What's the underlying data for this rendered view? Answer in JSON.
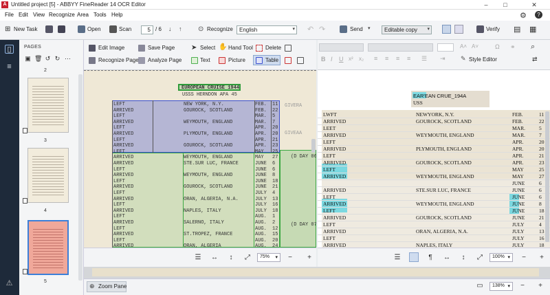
{
  "window": {
    "title": "Untitled project [5] - ABBYY FineReader 14 OCR Editor",
    "app_icon": "abbyy-icon"
  },
  "menu": [
    "File",
    "Edit",
    "View",
    "Recognize",
    "Area",
    "Tools",
    "Help"
  ],
  "toolbar": {
    "new_task": "New Task",
    "open": "Open",
    "scan": "Scan",
    "page_current": "5",
    "page_total": "/ 6",
    "recognize": "Recognize",
    "language": "English",
    "send": "Send",
    "editable": "Editable copy",
    "verify": "Verify"
  },
  "pages": {
    "header": "PAGES",
    "thumbs": [
      {
        "num": "2"
      },
      {
        "num": "3"
      },
      {
        "num": "4"
      },
      {
        "num": "5",
        "selected": true
      }
    ]
  },
  "image_tools": {
    "edit_image": "Edit Image",
    "save_page": "Save Page",
    "select": "Select",
    "hand_tool": "Hand Tool",
    "delete": "Delete",
    "recognize_page": "Recognize Page",
    "analyze_page": "Analyze Page",
    "text": "Text",
    "picture": "Picture",
    "table": "Table"
  },
  "text_tools": {
    "style_editor": "Style Editor"
  },
  "scan": {
    "title": "EUROPEAN CRUISE 1944",
    "subtitle": "USSS HERNDON APA 45",
    "rows": [
      [
        "LEFT",
        "NEW YORK, N.Y.",
        "FEB.",
        "11"
      ],
      [
        "ARRIVED",
        "GOUROCK, SCOTLAND",
        "FEB.",
        "22"
      ],
      [
        "LEFT",
        "",
        "MAR.",
        "5"
      ],
      [
        "ARRIVED",
        "WEYMOUTH, ENGLAND",
        "MAR.",
        "7"
      ],
      [
        "LEFT",
        "",
        "APR.",
        "20"
      ],
      [
        "ARRIVED",
        "PLYMOUTH, ENGLAND",
        "APR.",
        "20"
      ],
      [
        "LEFT",
        "",
        "APR.",
        "21"
      ],
      [
        "ARRIVED",
        "GOUROCK, SCOTLAND",
        "APR.",
        "23"
      ],
      [
        "LEFT",
        "",
        "MAY",
        "25"
      ],
      [
        "ARRIVED",
        "WEYMOUTH, ENGLAND",
        "MAY",
        "27"
      ],
      [
        "ARRIVED",
        "STE.SUR LUC, FRANCE",
        "JUNE",
        "6"
      ],
      [
        "LEFT",
        "",
        "JUNE",
        "6"
      ],
      [
        "ARRIVED",
        "WEYMOUTH, ENGLAND",
        "JUNE",
        "8"
      ],
      [
        "LEFT",
        "",
        "JUNE",
        "18"
      ],
      [
        "ARRIVED",
        "GOUROCK, SCOTLAND",
        "JUNE",
        "21"
      ],
      [
        "LEFT",
        "",
        "JULY",
        "4"
      ],
      [
        "ARRIVED",
        "ORAN, ALGERIA, N.A.",
        "JULY",
        "13"
      ],
      [
        "LEFT",
        "",
        "JULY",
        "16"
      ],
      [
        "ARRIVED",
        "NAPLES, ITALY",
        "JULY",
        "18"
      ],
      [
        "LEFT",
        "",
        "AUG.",
        "1"
      ],
      [
        "ARRIVED",
        "SALERNO, ITALY",
        "AUG.",
        "2"
      ],
      [
        "LEFT",
        "",
        "AUG.",
        "12"
      ],
      [
        "ARRIVED",
        "ST.TROPEZ, FRANCE",
        "AUG.",
        "15"
      ],
      [
        "LEFT",
        "",
        "AUG.",
        "20"
      ],
      [
        "ARRIVED",
        "ORAN, ALGERIA",
        "AUG.",
        "24"
      ]
    ],
    "annot1": "(D DAY 0645",
    "annot2": "(D DAY 0700"
  },
  "text": {
    "title": "EAR'EAN CRUE_194A",
    "subtitle": "USS",
    "rows": [
      [
        "LWFT",
        "NEWYORK,  N.Y.",
        "FEB.",
        "11"
      ],
      [
        "ARRIVED",
        "GOUROCK,   SCOTLAND",
        "FEB.",
        "22"
      ],
      [
        "LEET",
        "",
        "MAR.",
        "5"
      ],
      [
        "ARRIVED",
        "WEYMOUTH,   ENGLAND",
        "MAR.",
        "7"
      ],
      [
        "LEFT",
        "",
        "APR.",
        "20"
      ],
      [
        "ARRIVED",
        "PLYMOUTH,   ENGLAND",
        "APR.",
        "20"
      ],
      [
        "LEFT",
        "",
        "APR.",
        "21"
      ],
      [
        "ARRIVED",
        "GOUROCK,   SCOTLAND",
        "APR.",
        "23"
      ],
      [
        "LEFT",
        "",
        "MAY",
        "25"
      ],
      [
        "ARRIVED",
        "WEYMOUTH,  ENGLAND",
        "MAY",
        "27"
      ],
      [
        "",
        "",
        "JUNE",
        "6"
      ],
      [
        "ARRIVED",
        "STE.SUR LUC, FRANCE",
        "JUNE",
        "6"
      ],
      [
        "LEFT",
        "",
        "JUNE",
        "6"
      ],
      [
        "ARRIVED",
        "WEYMOUTH, ENGLAND",
        "JUNE",
        "8"
      ],
      [
        "LEFT",
        "",
        "JUNE",
        "18"
      ],
      [
        "ARRIVED",
        "GOUROCK, SCOTLAND",
        "JUNE",
        "21"
      ],
      [
        "LEFT",
        "",
        "JULY",
        "4"
      ],
      [
        "ARRIVED",
        "ORAN, ALGERIA, N.A.",
        "JULY",
        "13"
      ],
      [
        "LEFT",
        "",
        "JULY",
        "16"
      ],
      [
        "ARRIVED",
        "NAPLES, ITALY",
        "JULY",
        "18"
      ]
    ]
  },
  "image_status": {
    "zoom": "75%"
  },
  "text_status": {
    "zoom": "100%"
  },
  "bottom": {
    "zoom_pane": "Zoom Pane",
    "zoom": "138%"
  },
  "colors": {
    "accent": "#3c7fd8",
    "rail": "#1e2a3a",
    "table_area": "#3a4fd0",
    "text_area": "#4caf50",
    "selected_thumb": "#f0a89a"
  }
}
